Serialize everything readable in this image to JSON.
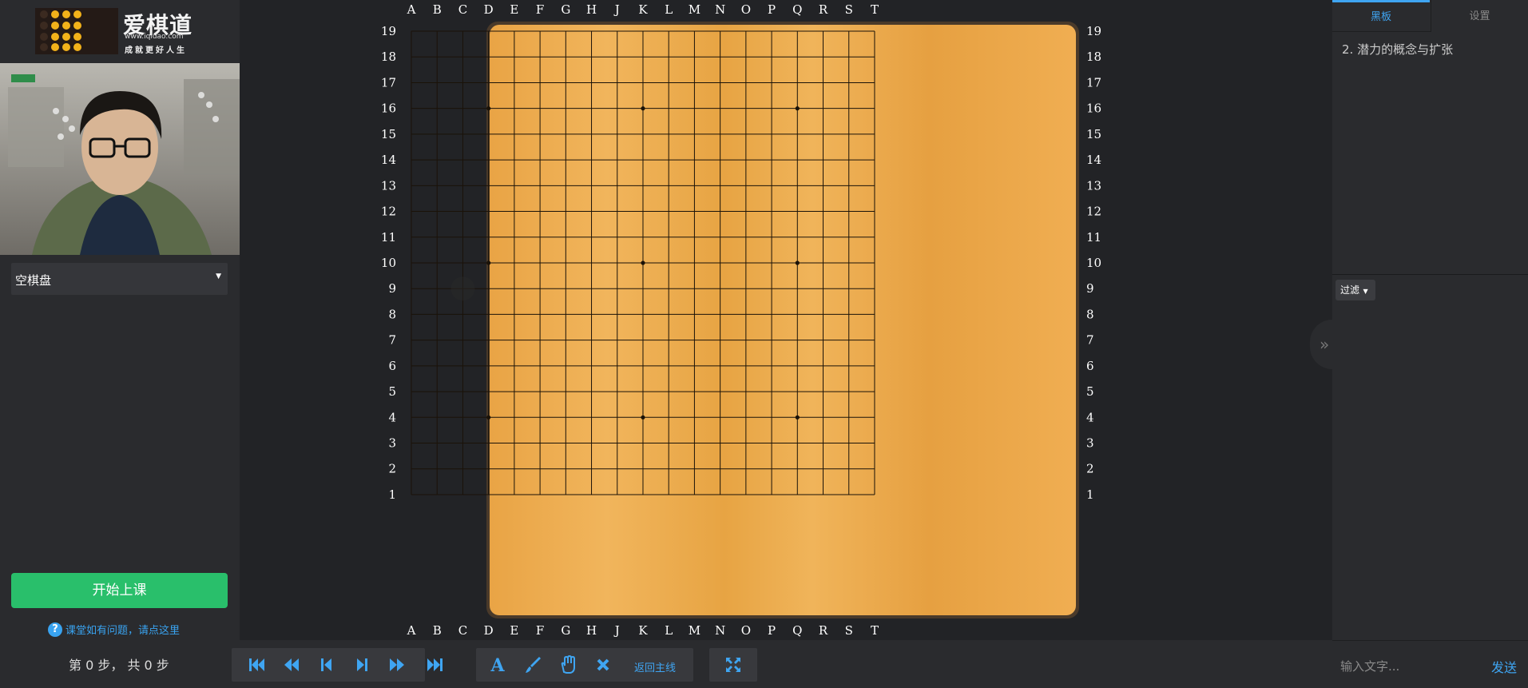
{
  "logo": {
    "name": "爱棋道",
    "url": "www.iqidao.com",
    "slogan": "成就更好人生"
  },
  "left": {
    "board_select": {
      "value": "空棋盘"
    },
    "start_button": "开始上课",
    "help_icon": "?",
    "help_link": "课堂如有问题，请点这里"
  },
  "bottom": {
    "step_text": "第 0 步， 共 0 步",
    "return_mainline": "返回主线",
    "nav_icons": [
      "first-move-icon",
      "back-many-icon",
      "prev-move-icon",
      "next-move-icon",
      "forward-many-icon",
      "last-move-icon"
    ],
    "tool_icons": [
      "text-tool-icon",
      "brush-icon",
      "hand-icon",
      "clear-icon"
    ],
    "fullscreen_icon": "fullscreen-icon"
  },
  "board": {
    "size": 19,
    "col_labels": [
      "A",
      "B",
      "C",
      "D",
      "E",
      "F",
      "G",
      "H",
      "J",
      "K",
      "L",
      "M",
      "N",
      "O",
      "P",
      "Q",
      "R",
      "S",
      "T"
    ],
    "row_labels": [
      "19",
      "18",
      "17",
      "16",
      "15",
      "14",
      "13",
      "12",
      "11",
      "10",
      "9",
      "8",
      "7",
      "6",
      "5",
      "4",
      "3",
      "2",
      "1"
    ],
    "star_points": [
      "D16",
      "K16",
      "Q16",
      "D10",
      "K10",
      "Q10",
      "D4",
      "K4",
      "Q4"
    ],
    "hover_stone": "C9",
    "colors": {
      "wood": "#eaa84a",
      "frame": "#4a3a2a",
      "line": "#1a1208"
    }
  },
  "right": {
    "tabs": [
      "黑板",
      "设置"
    ],
    "active_tab": "黑板",
    "lesson_title": "2. 潜力的概念与扩张",
    "filter": "过滤",
    "chat_placeholder": "输入文字...",
    "send": "发送",
    "collapse_icon": "double-chevron-right-icon"
  },
  "colors": {
    "accent": "#3fa5f2",
    "start_green": "#29bf6b"
  }
}
